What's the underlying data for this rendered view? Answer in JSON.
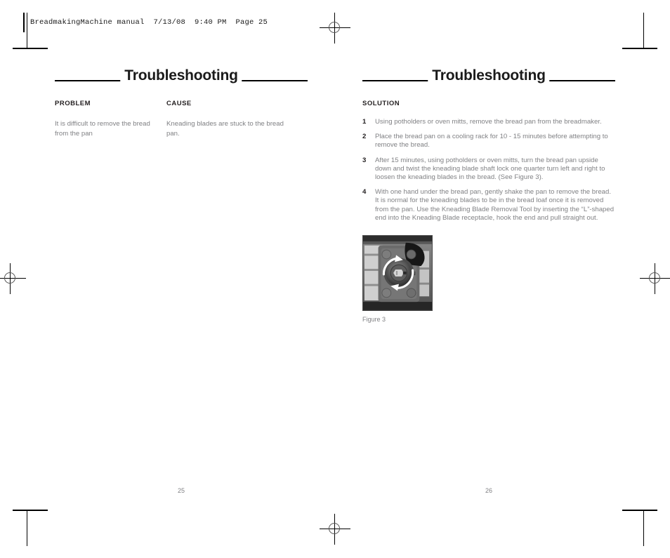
{
  "file_header": {
    "text": "BreadmakingMachine manual  7/13/08  9:40 PM  Page 25"
  },
  "left_page": {
    "title": "Troubleshooting",
    "columns": {
      "problem_header": "PROBLEM",
      "cause_header": "CAUSE",
      "problem_text": "It is difficult to remove the bread from the pan",
      "cause_text": "Kneading blades are stuck to the bread pan."
    },
    "page_number": "25"
  },
  "right_page": {
    "title": "Troubleshooting",
    "solution_header": "SOLUTION",
    "steps": [
      {
        "number": "1",
        "text": "Using potholders or oven mitts, remove the bread pan from the breadmaker."
      },
      {
        "number": "2",
        "text": "Place the bread pan on a cooling rack for 10 - 15 minutes before attempting to remove the bread."
      },
      {
        "number": "3",
        "text": "After 15 minutes, using potholders or oven mitts, turn the bread pan upside down and twist the kneading blade shaft lock one quarter turn left and right to loosen the kneading blades in the bread. (See Figure 3)."
      },
      {
        "number": "4",
        "text": "With one hand under the bread pan, gently shake the pan to remove the bread. It is normal for the kneading blades to be in the bread loaf once it is removed from the pan. Use the Kneading Blade Removal Tool by inserting the “L”-shaped end into the Kneading Blade receptacle, hook the end and pull straight out."
      }
    ],
    "figure": {
      "caption": "Figure 3",
      "description": "Bottom of bread pan showing the kneading blade shaft lock with rotation arrows"
    },
    "page_number": "26"
  },
  "colors": {
    "body_text": "#808184",
    "heading_text": "#231f20",
    "rule": "#000000"
  }
}
